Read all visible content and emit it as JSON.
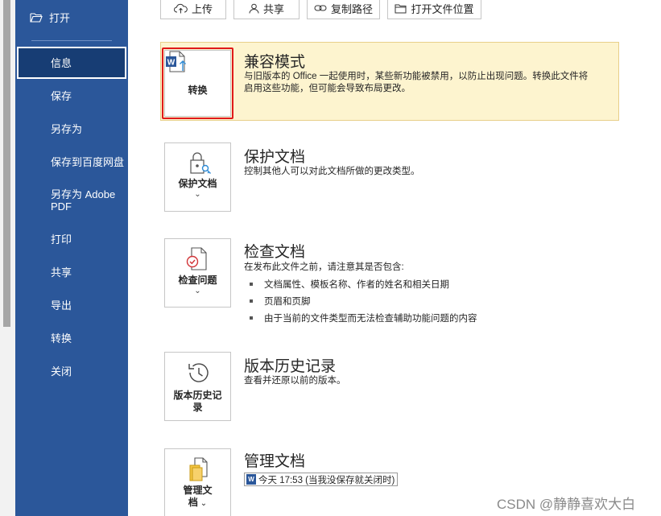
{
  "sidebar": {
    "open_label": "打开",
    "items": [
      {
        "label": "信息"
      },
      {
        "label": "保存"
      },
      {
        "label": "另存为"
      },
      {
        "label": "保存到百度网盘"
      },
      {
        "label": "另存为 Adobe PDF"
      },
      {
        "label": "打印"
      },
      {
        "label": "共享"
      },
      {
        "label": "导出"
      },
      {
        "label": "转换"
      },
      {
        "label": "关闭"
      }
    ]
  },
  "toolbar": {
    "upload": "上传",
    "share": "共享",
    "copy_path": "复制路径",
    "open_location": "打开文件位置"
  },
  "compat": {
    "tile_label": "转换",
    "title": "兼容模式",
    "desc_line1": "与旧版本的 Office 一起使用时，某些新功能被禁用，以防止出现问题。转换此文件将",
    "desc_line2": "启用这些功能，但可能会导致布局更改。"
  },
  "protect": {
    "tile_label": "保护文档",
    "title": "保护文档",
    "desc": "控制其他人可以对此文档所做的更改类型。"
  },
  "inspect": {
    "tile_label": "检查问题",
    "title": "检查文档",
    "desc": "在发布此文件之前，请注意其是否包含:",
    "bullets": [
      "文档属性、模板名称、作者的姓名和相关日期",
      "页眉和页脚",
      "由于当前的文件类型而无法检查辅助功能问题的内容"
    ]
  },
  "history": {
    "tile_label_1": "版本历史记",
    "tile_label_2": "录",
    "title": "版本历史记录",
    "desc": "查看并还原以前的版本。"
  },
  "manage": {
    "tile_label_1": "管理文",
    "tile_label_2": "档",
    "title": "管理文档",
    "version_entry": "今天 17:53 (当我没保存就关闭时)"
  },
  "watermark": "CSDN @静静喜欢大白",
  "colors": {
    "sidebar": "#2b579a",
    "banner": "#fdf4cf",
    "highlight": "#e01a1a"
  }
}
